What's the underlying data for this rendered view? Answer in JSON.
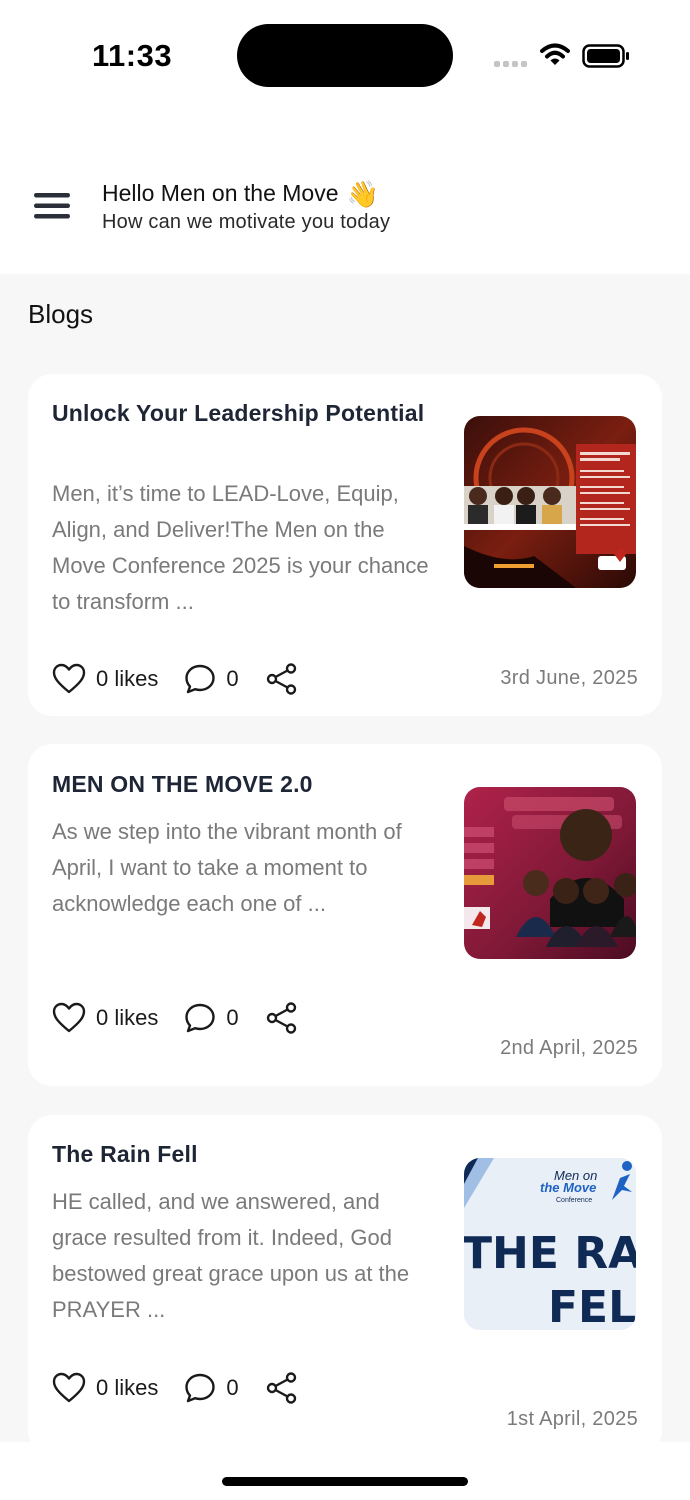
{
  "status_bar": {
    "time": "11:33"
  },
  "header": {
    "greeting": "Hello Men on the Move",
    "greeting_emoji": "👋",
    "subtitle": "How can we motivate you today"
  },
  "section": {
    "title": "Blogs"
  },
  "posts": [
    {
      "title": "Unlock  Your  Leadership Potential",
      "excerpt": "Men, it’s time to LEAD-Love, Equip, Align, and Deliver!The Men on the Move Conference 2025 is your chance to transform ...",
      "likes": "0 likes",
      "comments": "0",
      "date": "3rd June, 2025"
    },
    {
      "title": "MEN ON THE MOVE 2.0",
      "excerpt": "As we step into the vibrant month of April, I want to take a moment to acknowledge each one of ...",
      "likes": "0 likes",
      "comments": "0",
      "date": "2nd April, 2025"
    },
    {
      "title": "The Rain Fell",
      "excerpt": "HE called, and we answered, and grace resulted from it. Indeed, God bestowed great grace upon us at the PRAYER ...",
      "likes": "0 likes",
      "comments": "0",
      "date": "1st April, 2025",
      "thumb_text_1": "THE RAIN",
      "thumb_text_2": "FELL",
      "thumb_logo_1": "Men on",
      "thumb_logo_2": "the Move",
      "thumb_logo_3": "Conference"
    }
  ],
  "colors": {
    "background": "#f7f7f7",
    "card": "#ffffff",
    "title_text": "#1e2535",
    "muted_text": "#7a7a7a",
    "thumb_navy": "#102a56",
    "thumb_blue": "#1e63c4"
  }
}
